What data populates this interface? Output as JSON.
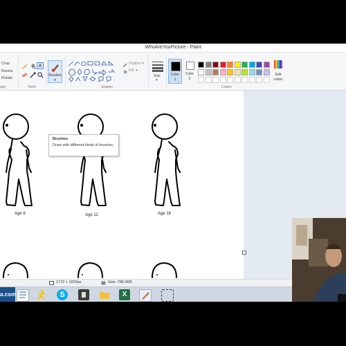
{
  "window": {
    "title": "WhoAreYouPicture - Paint"
  },
  "ribbon": {
    "image_group": {
      "crop": "Crop",
      "resize": "Resize",
      "rotate": "Rotate",
      "label": "age"
    },
    "tools_group": {
      "label": "Tools"
    },
    "brushes": {
      "label": "Brushes"
    },
    "shapes_group": {
      "label": "Shapes",
      "outline": "Outline",
      "fill": "Fill"
    },
    "size": {
      "label": "Size"
    },
    "color1": {
      "label": "Color",
      "num": "1"
    },
    "color2": {
      "label": "Color",
      "num": "2"
    },
    "colors_group": {
      "label": "Colors"
    },
    "edit_colors": {
      "line1": "Edit",
      "line2": "colors"
    },
    "palette_row1": [
      "#000000",
      "#7f7f7f",
      "#880015",
      "#ed1c24",
      "#ff7f27",
      "#fff200",
      "#22b14c",
      "#00a2e8",
      "#3f48cc",
      "#a349a4"
    ],
    "palette_row2": [
      "#ffffff",
      "#c3c3c3",
      "#b97a57",
      "#ffaec9",
      "#ffc90e",
      "#efe4b0",
      "#b5e61d",
      "#99d9ea",
      "#7092be",
      "#c8bfe7"
    ]
  },
  "tooltip": {
    "title": "Brushes",
    "description": "Draw with different kinds of brushes."
  },
  "canvas": {
    "labels": [
      "Age 8",
      "Age 12",
      "Age 16"
    ]
  },
  "statusbar": {
    "dimensions": "1772 × 1920px",
    "size": "Size: 785.9KB"
  },
  "taskbar": {
    "start_text": "a.com"
  },
  "colors": {
    "accent": "#0078d7",
    "ribbon_bg": "#f5f6f7",
    "canvas_bg": "#e4eaf2"
  }
}
